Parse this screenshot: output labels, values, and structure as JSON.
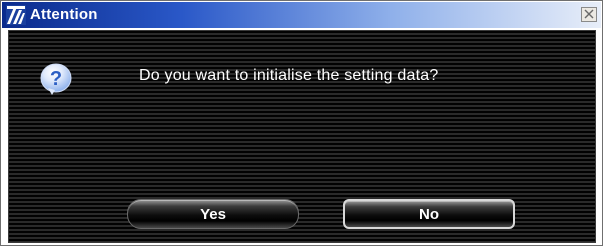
{
  "window": {
    "title": "Attention",
    "app_icon": "app-logo-icon",
    "close_icon": "close-icon"
  },
  "dialog": {
    "icon": "question-icon",
    "message": "Do you want to initialise the setting data?",
    "buttons": {
      "yes_label": "Yes",
      "no_label": "No"
    }
  },
  "colors": {
    "titlebar_start": "#0a2a8c",
    "titlebar_end": "#e8eef9",
    "body_background": "#0c0c0c",
    "text": "#ffffff",
    "question_icon": "#3a74d6"
  }
}
